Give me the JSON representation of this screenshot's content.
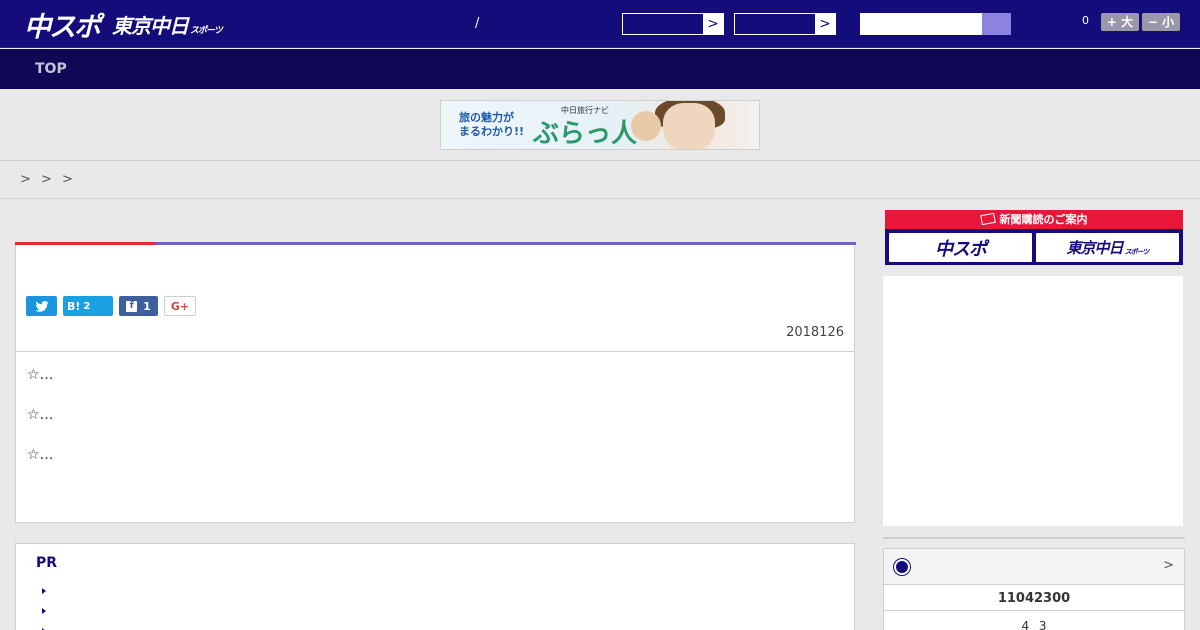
{
  "header": {
    "logo_main": "中スポ",
    "logo_sub": "東京中日",
    "logo_sub_small": "スポーツ",
    "slash": "/",
    "count": "0",
    "font_bigger_label": "+ 大",
    "font_smaller_label": "− 小",
    "select_arrow": ">"
  },
  "nav": {
    "top_label": "TOP"
  },
  "banner": {
    "catch": "旅の魅力が\nまるわかり!!",
    "small": "中日旅行ナビ",
    "brand": "ぶらっ人"
  },
  "breadcrumb": "> > >",
  "article": {
    "share_hatena_label": "B!",
    "share_hatena_count": "2",
    "share_facebook_count": "1",
    "share_gplus_label": "G+",
    "date": "2018126",
    "paragraphs": [
      "☆…",
      "☆…",
      "☆…"
    ]
  },
  "pr": {
    "title": "PR"
  },
  "subscribe": {
    "heading": "新聞購読のご案内",
    "option_chuspo": "中スポ",
    "option_tokyo": "東京中日",
    "option_tokyo_small": "スポーツ"
  },
  "widget": {
    "more": ">",
    "value1": "11042300",
    "value2": "4 3"
  },
  "colors": {
    "header_bg": "#150c7c",
    "nav_bg": "#0e0857",
    "accent_red": "#e8283a",
    "accent_purple": "#6e64c0",
    "twitter": "#1b95e0",
    "facebook": "#3f5f9c"
  }
}
